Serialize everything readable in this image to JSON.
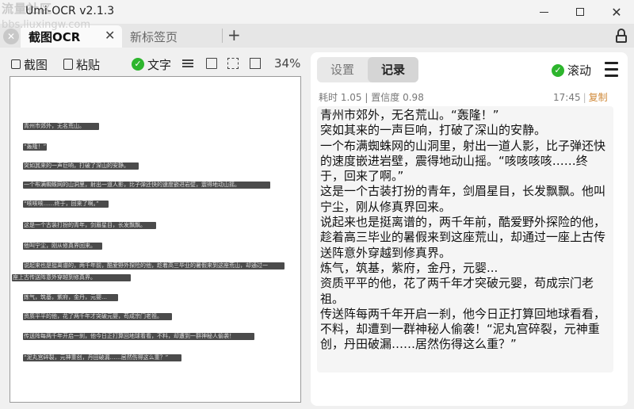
{
  "window": {
    "title": "Umi-OCR v2.1.3",
    "watermark_line1": "流量社区",
    "watermark_line2": "bbs.liuxingw.com"
  },
  "tabs": [
    {
      "label": "截图OCR",
      "active": true
    },
    {
      "label": "新标签页",
      "active": false
    }
  ],
  "left_toolbar": {
    "screenshot_label": "截图",
    "paste_label": "粘贴",
    "text_toggle_label": "文字",
    "zoom": "34%"
  },
  "image_preview": {
    "lines": [
      "青州市郊外，无名荒山。",
      "“轰隆！”",
      "突如其来的一声巨响，打破了深山的安静。",
      "一个布满蜘蛛网的山洞里，射出一道人影，比子弹还快的速度嵌进岩壁，震得地动山摇。",
      "“咳咳咳……终于，回来了啊。”",
      "这是一个古装打扮的青年，剑眉星目，长发飘飘。",
      "他叫宁尘，刚从修真界回来。",
      "说起来也是挺离谱的，两千年前，酷爱野外探险的他，趁着高三毕业的暑假来到这座荒山，却通过一",
      "座上古传送阵意外穿越到修真界。",
      "炼气，筑基，紫府，金丹，元婴…",
      "资质平平的他，花了两千年才突破元婴，苟成宗门老祖。",
      "传送阵每两千年开启一刹，他今日正打算回地球看看，不料，却遭到一群神秘人偷袭！",
      "“泥丸宫碎裂，元神重创，丹田破漏……居然伤得这么重？”"
    ]
  },
  "right_panel": {
    "tab_settings": "设置",
    "tab_records": "记录",
    "scroll_label": "滚动",
    "record": {
      "elapsed_label": "耗时",
      "elapsed": "1.05",
      "divider": "|",
      "confidence_label": "置信度",
      "confidence": "0.98",
      "time": "17:45",
      "copy_label": "复制",
      "text": "青州市郊外，无名荒山。“轰隆！”\n突如其来的一声巨响，打破了深山的安静。\n一个布满蜘蛛网的山洞里，射出一道人影，比子弹还快的速度嵌进岩壁，震得地动山摇。“咳咳咳咳……终于，回来了啊。”\n这是一个古装打扮的青年，剑眉星目，长发飘飘。他叫宁尘，刚从修真界回来。\n说起来也是挺离谱的，两千年前，酷爱野外探险的他，趁着高三毕业的暑假来到这座荒山，却通过一座上古传送阵意外穿越到修真界。\n炼气，筑基，紫府，金丹，元婴...\n资质平平的他，花了两千年才突破元婴，苟成宗门老祖。\n传送阵每两千年开启一刹，他今日正打算回地球看看，不料，却遭到一群神秘人偷袭！“泥丸宫碎裂，元神重创，丹田破漏……居然伤得这么重？”"
    }
  },
  "colors": {
    "accent_green": "#2db52d",
    "copy_orange": "#d08a3a"
  },
  "icons": [
    "close-icon",
    "add-tab-icon",
    "lock-icon",
    "screenshot-icon",
    "paste-icon",
    "check-icon",
    "list-icon",
    "file-icon",
    "frame-icon",
    "panel-icon",
    "menu-icon",
    "minimize-icon",
    "maximize-icon"
  ]
}
